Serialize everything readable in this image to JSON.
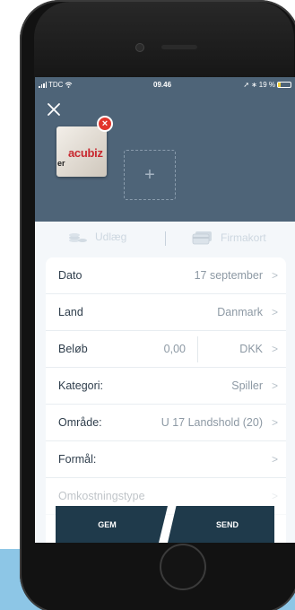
{
  "status_bar": {
    "carrier": "TDC",
    "time": "09.46",
    "battery_text": "19 %",
    "battery_level": 0.19
  },
  "attachments": {
    "receipt_logo_text": "acubiz",
    "receipt_partial_text": "er",
    "remove_symbol": "×",
    "add_symbol": "+"
  },
  "tabs": [
    {
      "label": "Udlæg",
      "icon": "coins-icon"
    },
    {
      "label": "Firmakort",
      "icon": "credit-card-icon"
    }
  ],
  "form": {
    "rows": [
      {
        "label": "Dato",
        "value": "17 september"
      },
      {
        "label": "Land",
        "value": "Danmark"
      },
      {
        "label": "Beløb",
        "amount": "0,00",
        "currency": "DKK"
      },
      {
        "label": "Kategori:",
        "value": "Spiller"
      },
      {
        "label": "Område:",
        "value": "U 17 Landshold (20)"
      },
      {
        "label": "Formål:",
        "value": ""
      },
      {
        "label": "Omkostningstype",
        "value": ""
      }
    ],
    "chevron": ">"
  },
  "actions": {
    "gem_label": "GEM",
    "send_label": "SEND"
  },
  "colors": {
    "header": "#4e6478",
    "action_bar": "#1f3a4b",
    "badge": "#e2352c",
    "accent_band": "#8dc6e6"
  }
}
